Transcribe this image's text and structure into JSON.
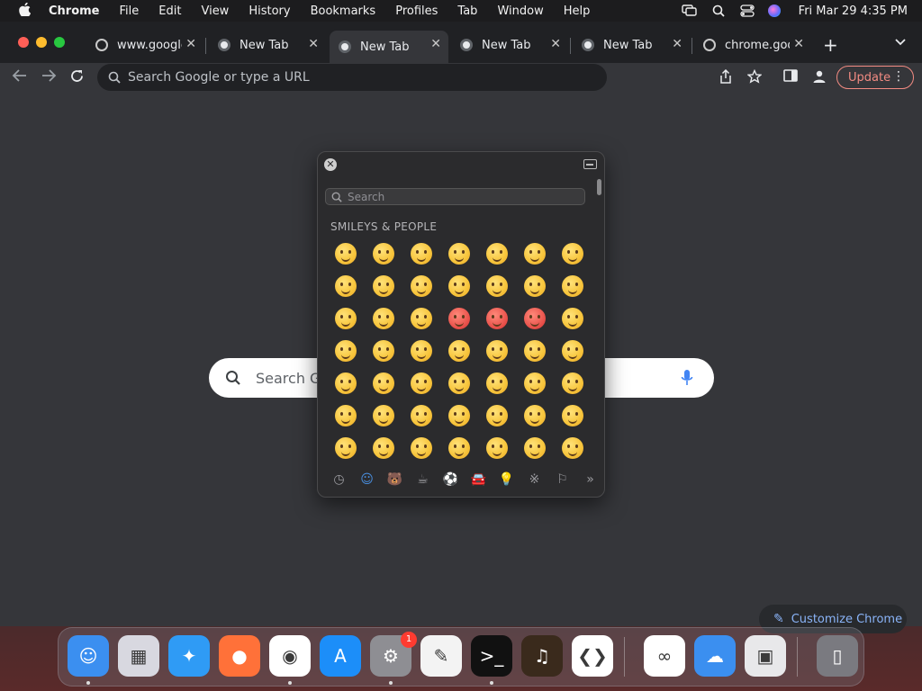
{
  "menubar": {
    "apple": "",
    "app_name": "Chrome",
    "items": [
      "File",
      "Edit",
      "View",
      "History",
      "Bookmarks",
      "Profiles",
      "Tab",
      "Window",
      "Help"
    ],
    "clock": "Fri Mar 29  4:35 PM"
  },
  "tabs": [
    {
      "title": "www.google.c",
      "active": false
    },
    {
      "title": "New Tab",
      "active": false
    },
    {
      "title": "New Tab",
      "active": true
    },
    {
      "title": "New Tab",
      "active": false
    },
    {
      "title": "New Tab",
      "active": false
    },
    {
      "title": "chrome.goo",
      "active": false
    }
  ],
  "tab_close": "✕",
  "new_tab": "+",
  "omnibox": {
    "placeholder": "Search Google or type a URL"
  },
  "update_button": "Update",
  "ntp": {
    "search_placeholder": "Search Google or type a URL",
    "customize_label": "Customize Chrome"
  },
  "emoji_picker": {
    "search_placeholder": "Search",
    "section_title": "SMILEYS & PEOPLE",
    "emojis": [
      "😀",
      "😃",
      "😄",
      "😁",
      "😆",
      "🥹",
      "😅",
      "😂",
      "🤣",
      "🥲",
      "☺️",
      "😊",
      "😇",
      "🙂",
      "🙃",
      "😉",
      "😌",
      "😍",
      "🥰",
      "😘",
      "😗",
      "😙",
      "😚",
      "😋",
      "😛",
      "😝",
      "😜",
      "🤪",
      "🤨",
      "🧐",
      "🤓",
      "😎",
      "🥸",
      "🤩",
      "🥳",
      "😏",
      "😒",
      "😞",
      "😔",
      "😟",
      "😕",
      "🙁",
      "☹️",
      "😣",
      "😖",
      "😫",
      "😩",
      "🥺",
      "😢"
    ],
    "categories": [
      {
        "name": "recent-icon",
        "glyph": "◷"
      },
      {
        "name": "smileys-icon",
        "glyph": "☺"
      },
      {
        "name": "animals-icon",
        "glyph": "🐻"
      },
      {
        "name": "food-icon",
        "glyph": "☕"
      },
      {
        "name": "activity-icon",
        "glyph": "⚽"
      },
      {
        "name": "travel-icon",
        "glyph": "🚘"
      },
      {
        "name": "objects-icon",
        "glyph": "💡"
      },
      {
        "name": "symbols-icon",
        "glyph": "※"
      },
      {
        "name": "flags-icon",
        "glyph": "⚐"
      },
      {
        "name": "more-icon",
        "glyph": "»"
      }
    ]
  },
  "dock": {
    "apps": [
      {
        "name": "finder",
        "glyph": "☺",
        "color": "#3b8ff0"
      },
      {
        "name": "launchpad",
        "glyph": "▦",
        "color": "#d8d8e0"
      },
      {
        "name": "safari",
        "glyph": "✦",
        "color": "#2f9bf5"
      },
      {
        "name": "firefox",
        "glyph": "●",
        "color": "#ff7139"
      },
      {
        "name": "chrome",
        "glyph": "◉",
        "color": "#ffffff"
      },
      {
        "name": "app-store",
        "glyph": "A",
        "color": "#1c8ef9"
      },
      {
        "name": "system-settings",
        "glyph": "⚙",
        "color": "#8e8e93",
        "badge": "1"
      },
      {
        "name": "textedit",
        "glyph": "✎",
        "color": "#f3f3f3"
      },
      {
        "name": "terminal",
        "glyph": ">_",
        "color": "#111111"
      },
      {
        "name": "garageband",
        "glyph": "♫",
        "color": "#3a2a1c"
      },
      {
        "name": "vscode",
        "glyph": "❮❯",
        "color": "#ffffff"
      },
      {
        "name": "visual-studio",
        "glyph": "∞",
        "color": "#ffffff"
      },
      {
        "name": "weather",
        "glyph": "☁",
        "color": "#3b8ff0"
      },
      {
        "name": "preview",
        "glyph": "▣",
        "color": "#e8e8ea"
      },
      {
        "name": "trash",
        "glyph": "▯",
        "color": "#7a7a80"
      }
    ]
  },
  "colors": {
    "update_accent": "#f28b82",
    "customize_accent": "#8ab4f8",
    "picker_active_category": "#4a90e2"
  }
}
